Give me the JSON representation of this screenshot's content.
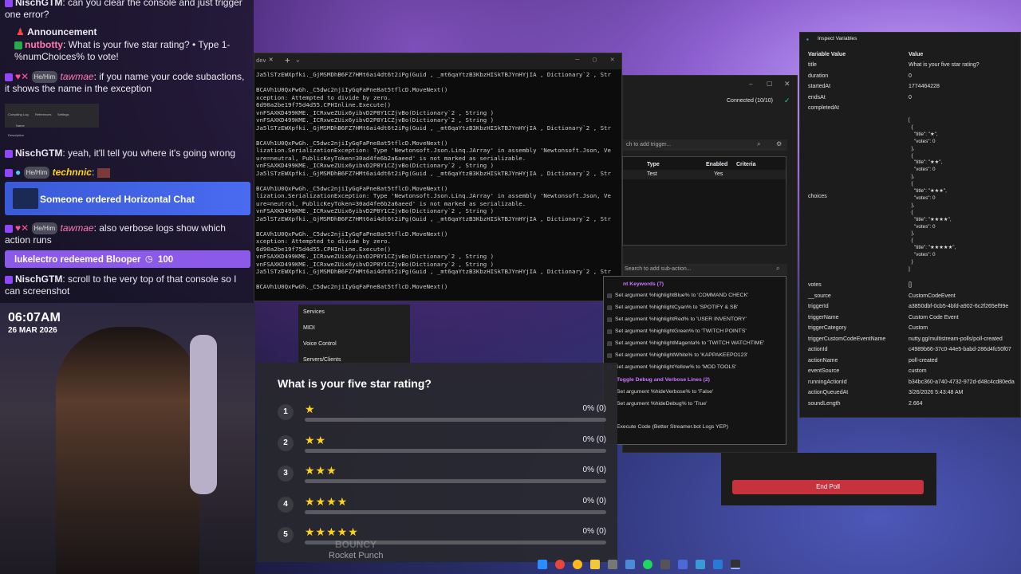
{
  "chat": {
    "messages": [
      {
        "user": "NischGTM",
        "text": ": can you clear the console and just trigger one error?"
      },
      {
        "label": "Announcement"
      },
      {
        "user": "nutbotty",
        "text": ": What is your five star rating? • Type 1-%numChoices% to vote!"
      },
      {
        "pronoun": "He/Him",
        "user": "tawmae",
        "text": ": if you name your code subactions, it shows the name in the exception"
      },
      {
        "user": "NischGTM",
        "text": ": yeah, it'll tell you where it's going wrong"
      },
      {
        "pronoun": "He/Him",
        "user": "technnic",
        "text": ":"
      },
      {
        "banner": "Someone ordered Horizontal Chat"
      },
      {
        "pronoun": "He/Him",
        "user": "tawmae",
        "text": ": also verbose logs show which action runs"
      },
      {
        "redeem": "lukelectro redeemed Blooper",
        "cost": "100"
      },
      {
        "user": "NischGTM",
        "text": ": scroll to the very top of that console so I can screenshot"
      }
    ],
    "thumb_tabs": [
      "Compiling Log",
      "References",
      "Settings"
    ],
    "thumb_fields": [
      "Name",
      "Description"
    ]
  },
  "clock": {
    "time": "06:07AM",
    "date": "26 MAR 2026"
  },
  "console": {
    "lines": [
      "Ja5lSTzEWXpfki._GjMSMDhB6FZ7HMt6ai4dt6t2iPg(Guid , _mt6qaYtzB3KbzHISkTBJYnHYjIA , Dictionary`2 , Str",
      "",
      "BCAVh1U0QxPwGh._C5dwc2njiIyGqFaPne8at5tflcD.MoveNext()",
      "xception: Attempted to divide by zero.",
      "6d90a2be19f75d4d55.CPHInline.Execute()",
      "vnFSAXKD499KME._ICRxweZUix6yibvD2P8Y1CZjvBo(Dictionary`2 , String )",
      "vnFSAXKD499KME._ICRxweZUix6yibvD2P8Y1CZjvBo(Dictionary`2 , String )",
      "Ja5lSTzEWXpfki._GjMSMDhB6FZ7HMt6ai4dt6t2iPg(Guid , _mt6qaYtzB3KbzHISkTBJYnHYjIA , Dictionary`2 , Str",
      "",
      "BCAVh1U0QxPwGh._C5dwc2njiIyGqFaPne8at5tflcD.MoveNext()",
      "lization.SerializationException: Type 'Newtonsoft.Json.Linq.JArray' in assembly 'Newtonsoft.Json, Ve",
      "ure=neutral, PublicKeyToken=30ad4fe6b2a6aeed' is not marked as serializable.",
      "vnFSAXKD499KME._ICRxweZUix6yibvD2P8Y1CZjvBo(Dictionary`2 , String )",
      "Ja5lSTzEWXpfki._GjMSMDhB6FZ7HMt6ai4dt6t2iPg(Guid , _mt6qaYtzB3KbzHISkTBJYnHYjIA , Dictionary`2 , Str",
      "",
      "BCAVh1U0QxPwGh._C5dwc2njiIyGqFaPne8at5tflcD.MoveNext()",
      "lization.SerializationException: Type 'Newtonsoft.Json.Linq.JArray' in assembly 'Newtonsoft.Json, Ve",
      "ure=neutral, PublicKeyToken=30ad4fe6b2a6aeed' is not marked as serializable.",
      "vnFSAXKD499KME._ICRxweZUix6yibvD2P8Y1CZjvBo(Dictionary`2 , String )",
      "Ja5lSTzEWXpfki._GjMSMDhB6FZ7HMt6ai4dt6t2iPg(Guid , _mt6qaYtzB3KbzHISkTBJYnHYjIA , Dictionary`2 , Str",
      "",
      "BCAVh1U0QxPwGh._C5dwc2njiIyGqFaPne8at5tflcD.MoveNext()",
      "xception: Attempted to divide by zero.",
      "6d90a2be19f75d4d55.CPHInline.Execute()",
      "vnFSAXKD499KME._ICRxweZUix6yibvD2P8Y1CZjvBo(Dictionary`2 , String )",
      "vnFSAXKD499KME._ICRxweZUix6yibvD2P8Y1CZjvBo(Dictionary`2 , String )",
      "Ja5lSTzEWXpfki._GjMSMDhB6FZ7HMt6ai4dt6t2iPg(Guid , _mt6qaYtzB3KbzHISkTBJYnHYjIA , Dictionary`2 , Str",
      "",
      "BCAVh1U0QxPwGh._C5dwc2njiIyGqFaPne8at5tflcD.MoveNext()"
    ]
  },
  "streamerbot": {
    "connection": "Connected (10/10)",
    "trigger_search": "ch to add trigger...",
    "trigger_cols": [
      "Type",
      "Enabled",
      "Criteria"
    ],
    "trigger_row": {
      "type": "Test",
      "enabled": "Yes"
    },
    "subaction_search": "Search to add sub-action...",
    "group1": "nt Keywords (7)",
    "subactions": [
      "Set argument %highlightBlue% to 'COMMAND CHECK'",
      "Set argument %highlightCyan% to 'SPOTIFY & SB'",
      "Set argument %highlightRed% to 'USER INVENTORY'",
      "Set argument %highlightGreen% to 'TWITCH POINTS'",
      "Set argument %highlightMagenta% to 'TWITCH WATCHTIME'",
      "Set argument %highlightWhite% to 'KAPPAKEEPO123'",
      "Set argument %highlightYellow% to 'MOD TOOLS'"
    ],
    "group2": "Toggle Debug and Verbose Lines (2)",
    "subactions2": [
      "Set argument %hideVerbose% to 'False'",
      "Set argument %hideDebug% to 'True'"
    ],
    "execute": "Execute Code (Better Streamer.bot Logs YEP)",
    "nav": [
      "Services",
      "MIDI",
      "Voice Control",
      "Servers/Clients"
    ],
    "end_poll": "End Poll"
  },
  "inspect": {
    "title": "Inspect Variables",
    "header": [
      "Variable Value",
      "Value"
    ],
    "rows": [
      [
        "title",
        "What is your five star rating?"
      ],
      [
        "duration",
        "0"
      ],
      [
        "startedAt",
        "1774464228"
      ],
      [
        "endsAt",
        "0"
      ],
      [
        "completedAt",
        ""
      ]
    ],
    "choices_label": "choices",
    "choices_json": [
      "[",
      "  {",
      "    \"title\": \"★\",",
      "    \"votes\": 0",
      "  },",
      "  {",
      "    \"title\": \"★★\",",
      "    \"votes\": 0",
      "  },",
      "  {",
      "    \"title\": \"★★★\",",
      "    \"votes\": 0",
      "  },",
      "  {",
      "    \"title\": \"★★★★\",",
      "    \"votes\": 0",
      "  },",
      "  {",
      "    \"title\": \"★★★★★\",",
      "    \"votes\": 0",
      "  }",
      "]"
    ],
    "rows2": [
      [
        "votes",
        "[]"
      ],
      [
        "__source",
        "CustomCodeEvent"
      ],
      [
        "triggerId",
        "a3850dbf-0cb5-4bfd-a902-6c2f265ef99e"
      ],
      [
        "triggerName",
        "Custom Code Event"
      ],
      [
        "triggerCategory",
        "Custom"
      ],
      [
        "triggerCustomCodeEventName",
        "nutty.gg/multistream-polls/poll-created"
      ],
      [
        "actionId",
        "c4989b66-37c0-44e5-babd-286d4fc50f07"
      ],
      [
        "actionName",
        "poll-created"
      ],
      [
        "eventSource",
        "custom"
      ],
      [
        "runningActionId",
        "b34bc360-a740-4732-972d-d48c4cd80eda"
      ],
      [
        "actionQueuedAt",
        "3/26/2026 5:43:48 AM"
      ],
      [
        "soundLength",
        "2.664"
      ]
    ]
  },
  "poll": {
    "question": "What is your five star rating?",
    "options": [
      {
        "num": "1",
        "stars": "★",
        "pct": "0% (0)"
      },
      {
        "num": "2",
        "stars": "★★",
        "pct": "0% (0)"
      },
      {
        "num": "3",
        "stars": "★★★",
        "pct": "0% (0)"
      },
      {
        "num": "4",
        "stars": "★★★★",
        "pct": "0% (0)"
      },
      {
        "num": "5",
        "stars": "★★★★★",
        "pct": "0% (0)"
      }
    ]
  },
  "overlay_game": [
    "BOUNCY",
    "Rocket Punch"
  ]
}
